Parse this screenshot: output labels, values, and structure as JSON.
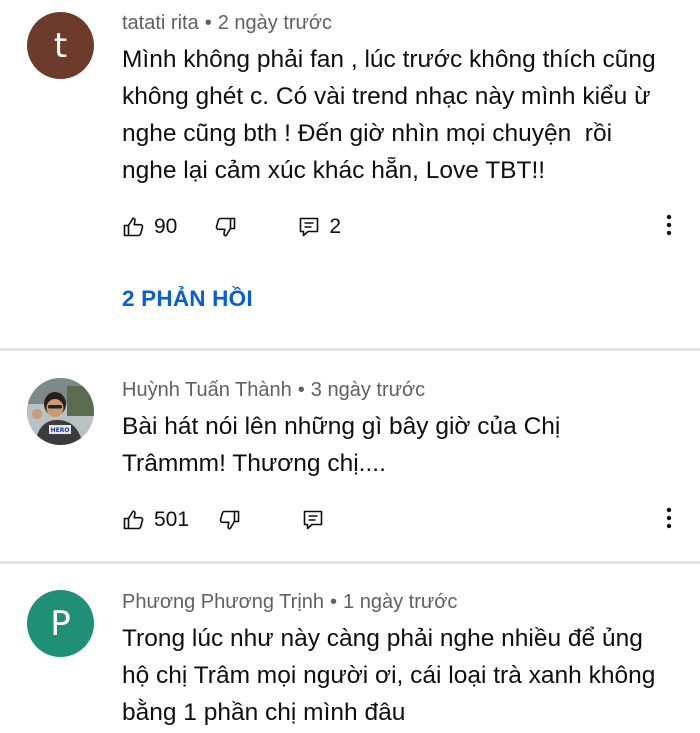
{
  "comments": [
    {
      "author": "tatati rita",
      "time": "2 ngày trước",
      "avatar_letter": "t",
      "avatar_color": "#6d3b2c",
      "text": "Mình không phải fan , lúc trước không thích cũng\nkhông ghét c. Có vài trend nhạc này mình kiểu ừ\nnghe cũng bth ! Đến giờ nhìn mọi chuyện  rồi\nnghe lại cảm xúc khác hẵn, Love TBT!!",
      "likes": "90",
      "reply_count": "2",
      "replies_label": "2 PHẢN HỒI"
    },
    {
      "author": "Huỳnh Tuấn Thành",
      "time": "3 ngày trước",
      "avatar_type": "photo",
      "text": "Bài hát nói lên những gì bây giờ của Chị\nTrâmmm! Thương chị....",
      "likes": "501"
    },
    {
      "author": "Phương Phương Trịnh",
      "time": "1 ngày trước",
      "avatar_letter": "P",
      "avatar_color": "#1f8f76",
      "text": "Trong lúc như này càng phải nghe nhiều để ủng\nhộ chị Trâm mọi người ơi, cái loại trà xanh không\nbằng 1 phần chị mình đâu"
    }
  ],
  "separator": "•",
  "colors": {
    "link_blue": "#065fd4",
    "meta_gray": "#606060",
    "divider": "#e3e3e3"
  },
  "icons": [
    "like-icon",
    "dislike-icon",
    "reply-icon",
    "more-vert-icon"
  ]
}
